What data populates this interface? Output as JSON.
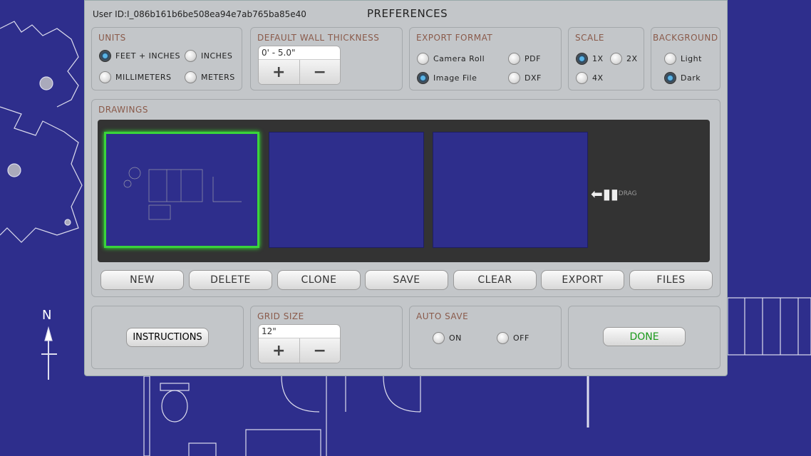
{
  "header": {
    "user_id": "User ID:I_086b161b6be508ea94e7ab765ba85e40",
    "title": "PREFERENCES"
  },
  "units": {
    "label": "UNITS",
    "options": [
      {
        "label": "FEET + INCHES",
        "selected": true
      },
      {
        "label": "INCHES",
        "selected": false
      },
      {
        "label": "MILLIMETERS",
        "selected": false
      },
      {
        "label": "METERS",
        "selected": false
      }
    ]
  },
  "wall": {
    "label": "DEFAULT WALL THICKNESS",
    "value": "0' - 5.0\"",
    "plus": "+",
    "minus": "−"
  },
  "export": {
    "label": "EXPORT FORMAT",
    "options": [
      {
        "label": "Camera Roll",
        "selected": false
      },
      {
        "label": "PDF",
        "selected": false
      },
      {
        "label": "Image File",
        "selected": true
      },
      {
        "label": "DXF",
        "selected": false
      }
    ]
  },
  "scale": {
    "label": "SCALE",
    "options": [
      {
        "label": "1X",
        "selected": true
      },
      {
        "label": "2X",
        "selected": false
      },
      {
        "label": "4X",
        "selected": false
      }
    ]
  },
  "background": {
    "label": "BACKGROUND",
    "options": [
      {
        "label": "Light",
        "selected": false
      },
      {
        "label": "Dark",
        "selected": true
      }
    ]
  },
  "drawings": {
    "label": "DRAWINGS",
    "drag": "DRAG",
    "actions": [
      "NEW",
      "DELETE",
      "CLONE",
      "SAVE",
      "CLEAR",
      "EXPORT",
      "FILES"
    ]
  },
  "instructions": "INSTRUCTIONS",
  "grid": {
    "label": "GRID SIZE",
    "value": "12\"",
    "plus": "+",
    "minus": "−"
  },
  "autosave": {
    "label": "AUTO SAVE",
    "options": [
      {
        "label": "ON",
        "selected": false
      },
      {
        "label": "OFF",
        "selected": false
      }
    ]
  },
  "done": "DONE",
  "compass": "N",
  "colors": {
    "accent": "#3ad43a",
    "blueprint": "#2e2e8c",
    "done": "#1a9a1a"
  }
}
